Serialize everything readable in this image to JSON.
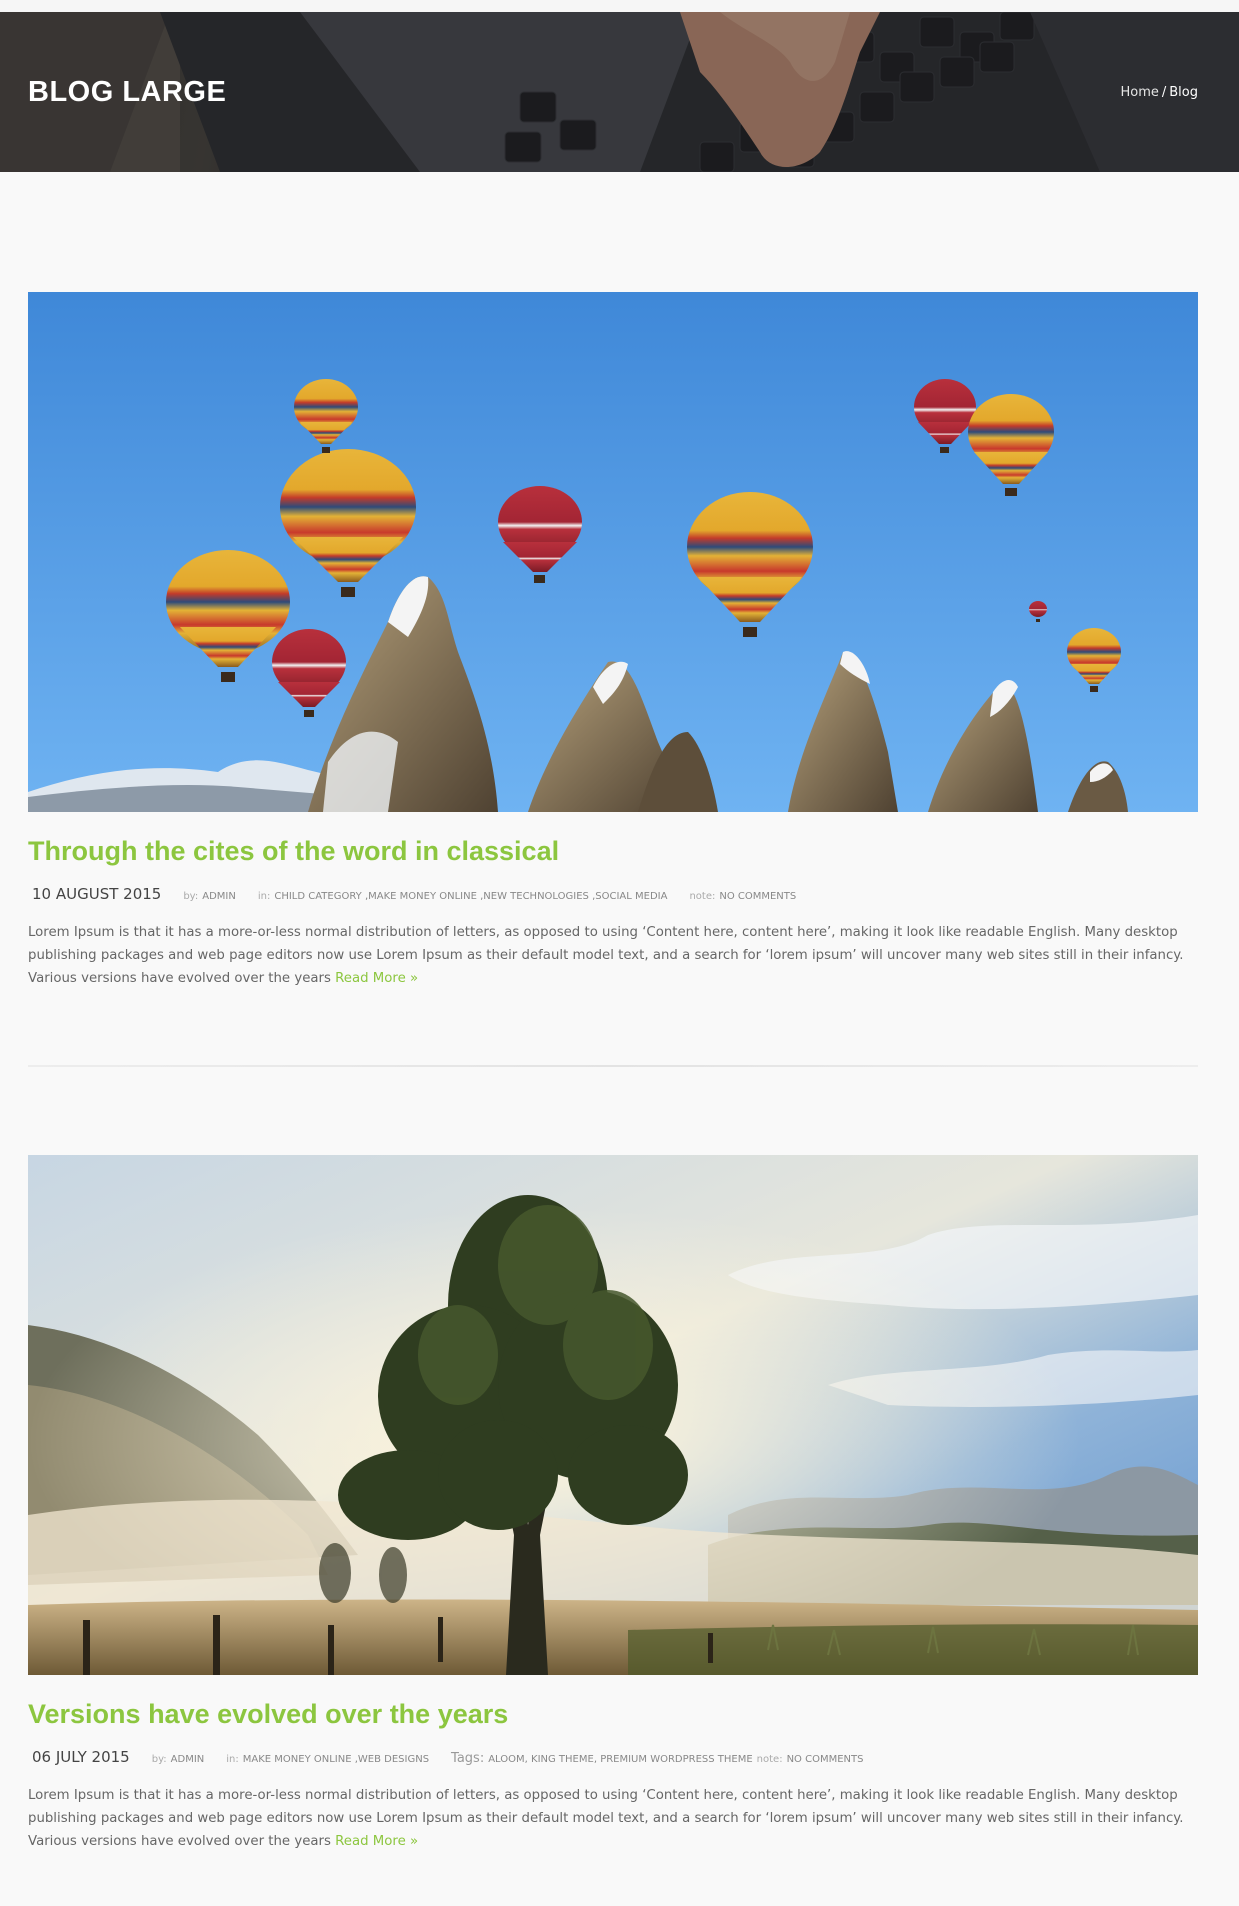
{
  "header": {
    "title": "BLOG LARGE",
    "breadcrumb": {
      "home": "Home",
      "separator": "/",
      "current": "Blog"
    }
  },
  "colors": {
    "accent": "#8cc63f",
    "background": "#f9f9f9",
    "banner": "#2f3035"
  },
  "posts": [
    {
      "image": "hot-air-balloons-over-rock-spires",
      "title": "Through the cites of the word in classical",
      "date": "10 AUGUST 2015",
      "by_label": "by:",
      "author": "ADMIN",
      "in_label": "in:",
      "categories": [
        "CHILD CATEGORY",
        "MAKE MONEY ONLINE",
        "NEW TECHNOLOGIES",
        "SOCIAL MEDIA"
      ],
      "note_label": "note:",
      "comments": "NO COMMENTS",
      "excerpt": "Lorem Ipsum is that it has a more-or-less normal distribution of letters, as opposed to using ‘Content here, content here’, making it look like readable English. Many desktop publishing packages and web page editors now use Lorem Ipsum as their default model text, and a search for ‘lorem ipsum’ will uncover many web sites still in their infancy. Various versions have evolved over the years",
      "read_more": "Read More »"
    },
    {
      "image": "tree-in-misty-meadow",
      "title": "Versions have evolved over the years",
      "date": "06 JULY 2015",
      "by_label": "by:",
      "author": "ADMIN",
      "in_label": "in:",
      "categories": [
        "MAKE MONEY ONLINE",
        "WEB DESIGNS"
      ],
      "tags_label": "Tags:",
      "tags": [
        "ALOOM",
        "KING THEME",
        "PREMIUM WORDPRESS THEME"
      ],
      "note_label": "note:",
      "comments": "NO COMMENTS",
      "excerpt": "Lorem Ipsum is that it has a more-or-less normal distribution of letters, as opposed to using ‘Content here, content here’, making it look like readable English. Many desktop publishing packages and web page editors now use Lorem Ipsum as their default model text, and a search for ‘lorem ipsum’ will uncover many web sites still in their infancy. Various versions have evolved over the years",
      "read_more": "Read More »"
    }
  ]
}
